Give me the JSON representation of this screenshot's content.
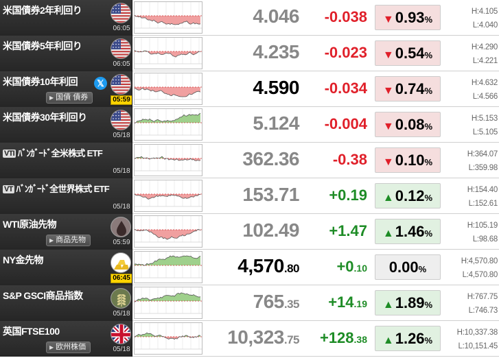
{
  "rows": [
    {
      "name": "米国債券2年利回り",
      "flag": "us-flag-icon",
      "time": "06:05",
      "time_hl": false,
      "price": "4.046",
      "price_dec": "",
      "price_dark": false,
      "change": "-0.038",
      "change_dec": "",
      "dir": "down",
      "arrow": "▼",
      "pct": "0.93",
      "pct_sym": "%",
      "high": "H:4.105",
      "low": "L:4.040",
      "chart": "down"
    },
    {
      "name": "米国債券5年利回り",
      "flag": "us-flag-icon",
      "time": "06:05",
      "time_hl": false,
      "price": "4.235",
      "price_dec": "",
      "price_dark": false,
      "change": "-0.023",
      "change_dec": "",
      "dir": "down",
      "arrow": "▼",
      "pct": "0.54",
      "pct_sym": "%",
      "high": "H:4.290",
      "low": "L:4.221",
      "chart": "down"
    },
    {
      "name": "米国債券10年利回",
      "flag": "us-flag-icon",
      "time": "05:59",
      "time_hl": true,
      "tag": "国債 債券",
      "xicon": "𝕏",
      "price": "4.590",
      "price_dec": "",
      "price_dark": true,
      "change": "-0.034",
      "change_dec": "",
      "dir": "down",
      "arrow": "▼",
      "pct": "0.74",
      "pct_sym": "%",
      "high": "H:4.632",
      "low": "L:4.566",
      "chart": "mixed"
    },
    {
      "name": "米国債券30年利回り",
      "flag": "us-flag-icon",
      "time": "05/18",
      "time_hl": false,
      "price": "5.124",
      "price_dec": "",
      "price_dark": false,
      "change": "-0.004",
      "change_dec": "",
      "dir": "down",
      "arrow": "▼",
      "pct": "0.08",
      "pct_sym": "%",
      "high": "H:5.153",
      "low": "L:5.105",
      "chart": "up"
    },
    {
      "name": "ﾊﾞﾝｶﾞｰﾄﾞ全米株式 ETF",
      "vti": "VTI",
      "flag": "",
      "time": "05/18",
      "time_hl": false,
      "price": "362.36",
      "price_dec": "",
      "price_dark": false,
      "change": "-0.38",
      "change_dec": "",
      "dir": "down",
      "arrow": "▼",
      "pct": "0.10",
      "pct_sym": "%",
      "high": "H:364.07",
      "low": "L:359.98",
      "chart": "down"
    },
    {
      "name": "ﾊﾞﾝｶﾞｰﾄﾞ全世界株式 ETF",
      "vti": "VT",
      "flag": "",
      "time": "05/18",
      "time_hl": false,
      "price": "153.71",
      "price_dec": "",
      "price_dark": false,
      "change": "+0.19",
      "change_dec": "",
      "dir": "up",
      "arrow": "▲",
      "pct": "0.12",
      "pct_sym": "%",
      "high": "H:154.40",
      "low": "L:152.61",
      "chart": "mixed"
    },
    {
      "name": "WTI原油先物",
      "flag": "oil-drop-icon",
      "time": "05:59",
      "time_hl": false,
      "tag": "商品先物",
      "price": "102.49",
      "price_dec": "",
      "price_dark": false,
      "change": "+1.47",
      "change_dec": "",
      "dir": "up",
      "arrow": "▲",
      "pct": "1.46",
      "pct_sym": "%",
      "high": "H:105.19",
      "low": "L:98.68",
      "chart": "mixed"
    },
    {
      "name": "NY金先物",
      "flag": "gold-bars-icon",
      "time": "06:45",
      "time_hl": true,
      "price": "4,570",
      "price_dec": ".80",
      "price_dark": true,
      "change": "+0",
      "change_dec": ".10",
      "dir": "up",
      "arrow": "",
      "pct": "0.00",
      "pct_sym": "%",
      "high": "H:4,570.80",
      "low": "L:4,570.80",
      "chart": "up"
    },
    {
      "name": "S&P GSCI商品指数",
      "flag": "wheat-icon",
      "time": "05/18",
      "time_hl": false,
      "price": "765",
      "price_dec": ".35",
      "price_dark": false,
      "change": "+14",
      "change_dec": ".19",
      "dir": "up",
      "arrow": "▲",
      "pct": "1.89",
      "pct_sym": "%",
      "high": "H:767.75",
      "low": "L:746.73",
      "chart": "up"
    },
    {
      "name": "英国FTSE100",
      "flag": "uk-flag-icon",
      "time": "05/18",
      "time_hl": false,
      "tag": "欧州株価",
      "price": "10,323",
      "price_dec": ".75",
      "price_dark": false,
      "change": "+128",
      "change_dec": ".38",
      "dir": "up",
      "arrow": "▲",
      "pct": "1.26",
      "pct_sym": "%",
      "high": "H:10,337.38",
      "low": "L:10,151.45",
      "chart": "up"
    }
  ]
}
